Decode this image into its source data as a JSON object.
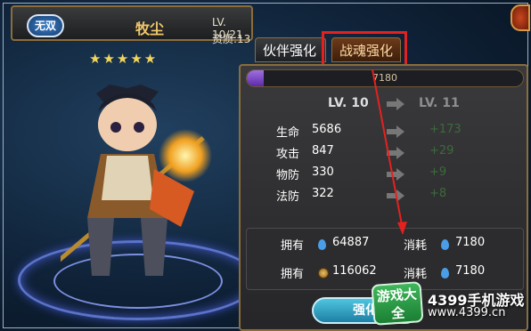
{
  "header": {
    "badge": "无双",
    "hero_name": "牧尘",
    "level": "LV. 10/21",
    "aptitude": "资质:13",
    "stars": "★★★★★"
  },
  "tabs": [
    {
      "label": "伙伴强化",
      "selected": false
    },
    {
      "label": "战魂强化",
      "selected": true
    }
  ],
  "exp": {
    "text": "7180",
    "progress": 0.06
  },
  "levels": {
    "current": "LV. 10",
    "next": "LV. 11"
  },
  "stats": [
    {
      "name": "生命",
      "value": "5686",
      "increase": "+173"
    },
    {
      "name": "攻击",
      "value": "847",
      "increase": "+29"
    },
    {
      "name": "物防",
      "value": "330",
      "increase": "+9"
    },
    {
      "name": "法防",
      "value": "322",
      "increase": "+8"
    }
  ],
  "costs": [
    {
      "own_label": "拥有",
      "own_icon": "soul-drop-icon",
      "own_value": "64887",
      "cost_label": "消耗",
      "cost_icon": "soul-drop-icon",
      "cost_value": "7180"
    },
    {
      "own_label": "拥有",
      "own_icon": "coin-icon",
      "own_value": "116062",
      "cost_label": "消耗",
      "cost_icon": "soul-drop-icon",
      "cost_value": "7180"
    }
  ],
  "button": {
    "label": "强化"
  },
  "watermark": {
    "logo": "游戏大全",
    "title": "4399手机游戏",
    "url": "www.4399.cn"
  },
  "colors": {
    "highlight": "#e5211f",
    "gold": "#f3c96c",
    "exp_fill": "#7a44c8",
    "button": "#2a9cc2"
  }
}
